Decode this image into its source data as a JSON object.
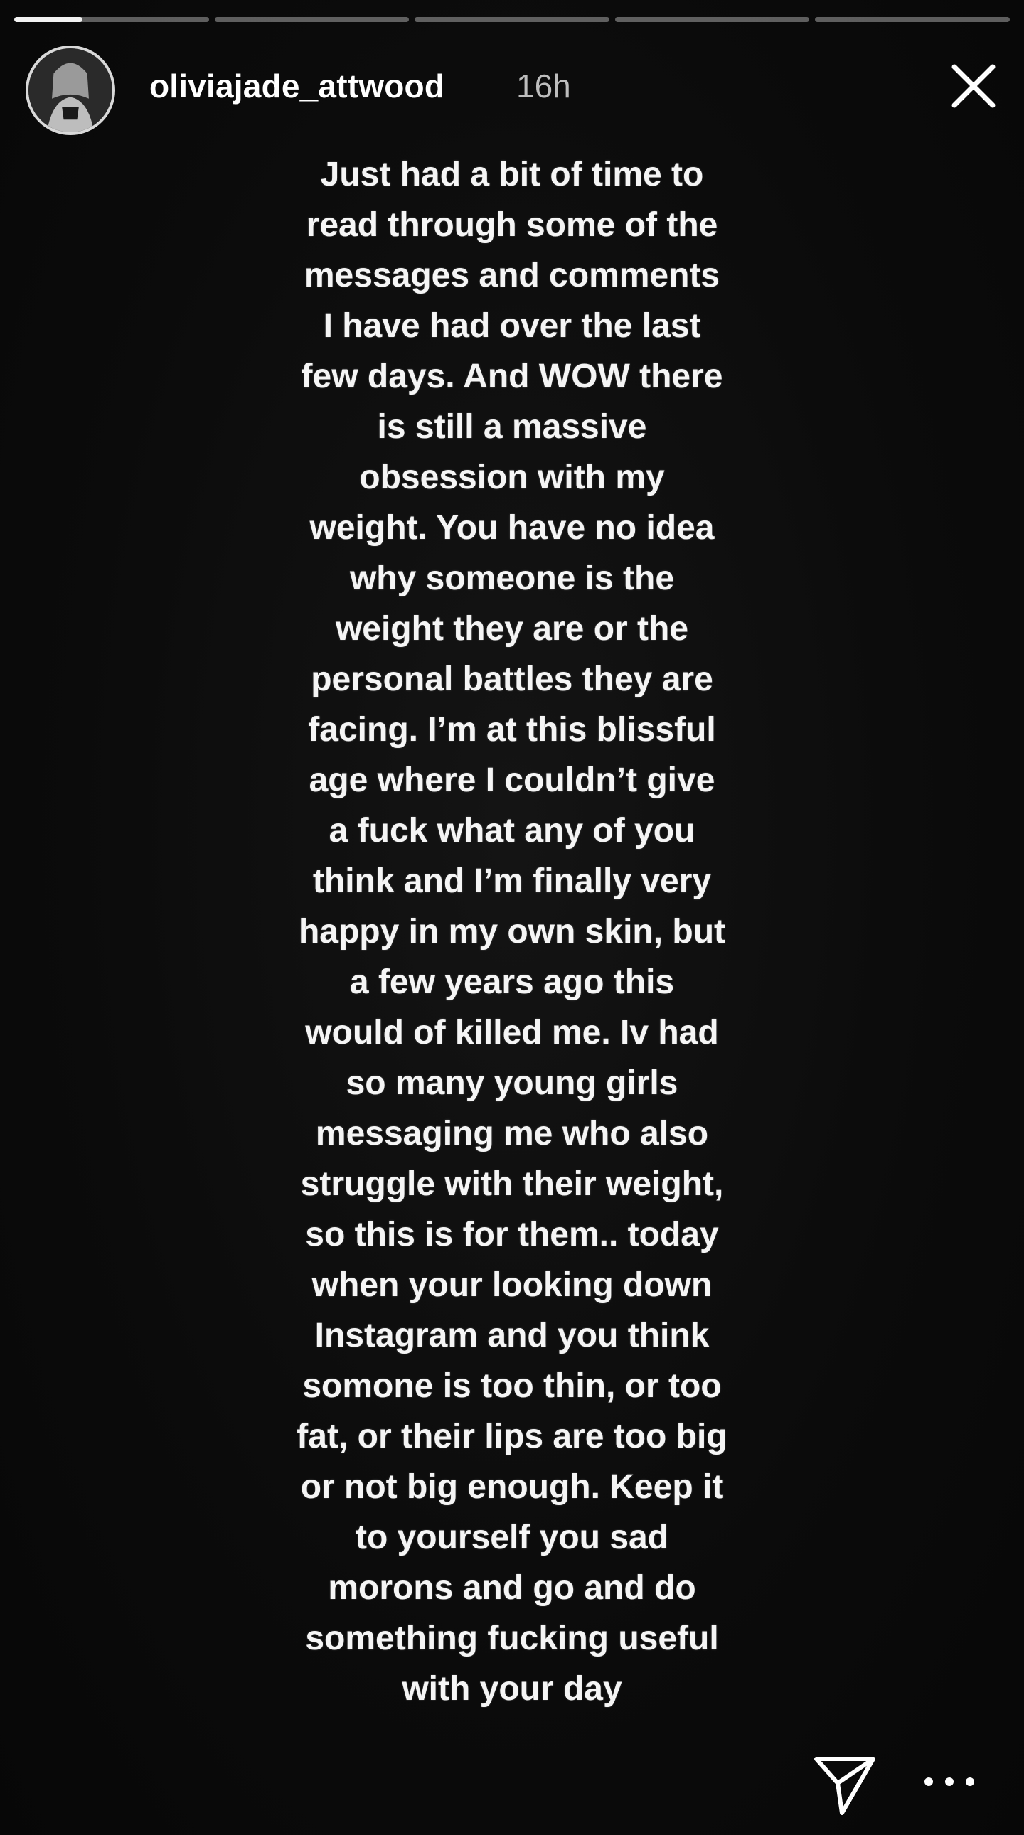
{
  "story": {
    "username": "oliviajade_attwood",
    "timestamp": "16h",
    "progress": {
      "segment_count": 5,
      "active_index": 0,
      "active_fraction": 0.35
    },
    "lines": [
      "Just had a bit of time to",
      "read through some of the",
      "messages and comments",
      "I have had over the last",
      "few days. And WOW there",
      "is still a massive",
      "obsession with my",
      "weight. You have no idea",
      "why someone is the",
      "weight they are or the",
      "personal battles they are",
      "facing. I’m at this blissful",
      "age where I couldn’t give",
      "a fuck what any of you",
      "think and I’m finally very",
      "happy in my own skin, but",
      "a few years ago this",
      "would of killed me. Iv had",
      "so many young girls",
      "messaging me who also",
      "struggle with their weight,",
      "so this is for them..  today",
      "when your looking down",
      "Instagram and you think",
      "somone is too thin, or too",
      "fat, or their lips are too big",
      "or not big enough. Keep it",
      "to yourself you sad",
      "morons and go and do",
      "something fucking useful",
      "with your day"
    ]
  },
  "icons": {
    "close": "close-icon",
    "share": "send-icon",
    "more": "more-options-icon"
  },
  "colors": {
    "background": "#0b0b0b",
    "text": "#f5f5f5",
    "timestamp": "#bdbdbd",
    "progress_track": "rgba(255,255,255,0.35)",
    "progress_fill": "#f2f2f2"
  }
}
